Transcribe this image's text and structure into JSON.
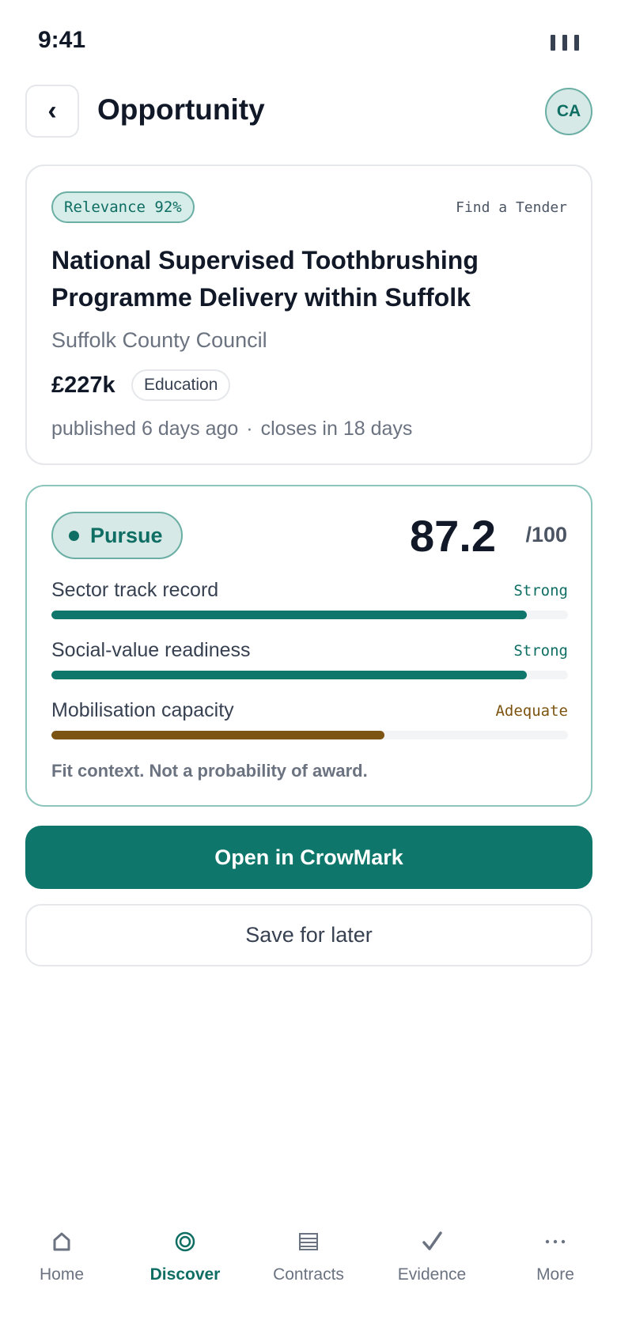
{
  "status_bar": {
    "time": "9:41"
  },
  "header": {
    "back_glyph": "‹",
    "title": "Opportunity",
    "avatar_initials": "CA"
  },
  "opportunity": {
    "relevance": "Relevance 92%",
    "source": "Find a Tender",
    "title": "National Supervised Toothbrushing Programme Delivery within Suffolk",
    "buyer": "Suffolk County Council",
    "value": "£227k",
    "sector": "Education",
    "published": "published 6 days ago",
    "separator": "·",
    "closes": "closes in 18 days"
  },
  "assessment": {
    "verdict": "Pursue",
    "score": "87.2",
    "score_max": "/100",
    "metrics": [
      {
        "label": "Sector track record",
        "rating": "Strong",
        "level": 0.92
      },
      {
        "label": "Social-value readiness",
        "rating": "Strong",
        "level": 0.92
      },
      {
        "label": "Mobilisation capacity",
        "rating": "Adequate",
        "level": 0.645
      }
    ],
    "footnote": "Fit context. Not a probability of award."
  },
  "actions": {
    "primary": "Open in CrowMark",
    "secondary": "Save for later"
  },
  "nav": {
    "items": [
      {
        "label": "Home",
        "icon": "home-icon",
        "active": false
      },
      {
        "label": "Discover",
        "icon": "discover-icon",
        "active": true
      },
      {
        "label": "Contracts",
        "icon": "contracts-icon",
        "active": false
      },
      {
        "label": "Evidence",
        "icon": "evidence-check-icon",
        "active": false
      },
      {
        "label": "More",
        "icon": "more-icon",
        "active": false
      }
    ]
  },
  "colors": {
    "accent": "#0f766b",
    "strong": "#0f6e63",
    "adequate": "#7c5414"
  }
}
